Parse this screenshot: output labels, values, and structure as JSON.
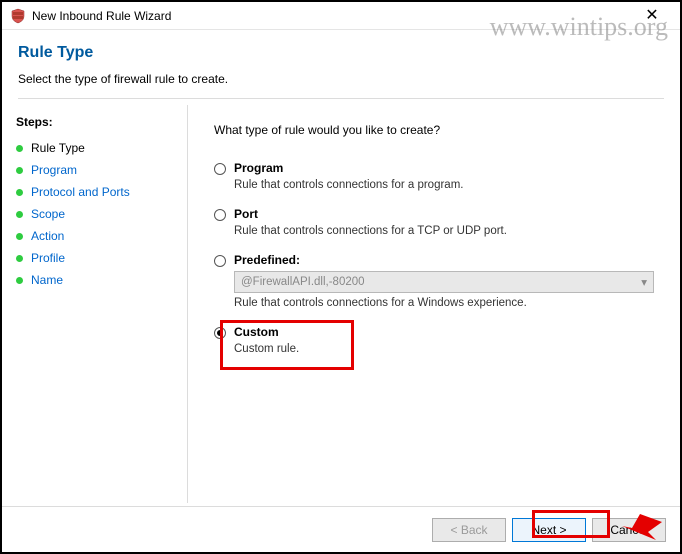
{
  "watermark": "www.wintips.org",
  "titlebar": {
    "title": "New Inbound Rule Wizard"
  },
  "header": {
    "title": "Rule Type",
    "description": "Select the type of firewall rule to create."
  },
  "sidebar": {
    "title": "Steps:",
    "items": [
      {
        "label": "Rule Type",
        "current": true
      },
      {
        "label": "Program"
      },
      {
        "label": "Protocol and Ports"
      },
      {
        "label": "Scope"
      },
      {
        "label": "Action"
      },
      {
        "label": "Profile"
      },
      {
        "label": "Name"
      }
    ]
  },
  "main": {
    "question": "What type of rule would you like to create?",
    "options": [
      {
        "key": "program",
        "label": "Program",
        "description": "Rule that controls connections for a program.",
        "checked": false
      },
      {
        "key": "port",
        "label": "Port",
        "description": "Rule that controls connections for a TCP or UDP port.",
        "checked": false
      },
      {
        "key": "predefined",
        "label": "Predefined:",
        "description": "Rule that controls connections for a Windows experience.",
        "checked": false,
        "dropdown_value": "@FirewallAPI.dll,-80200"
      },
      {
        "key": "custom",
        "label": "Custom",
        "description": "Custom rule.",
        "checked": true
      }
    ]
  },
  "footer": {
    "back": "< Back",
    "next": "Next >",
    "cancel": "Cancel"
  }
}
